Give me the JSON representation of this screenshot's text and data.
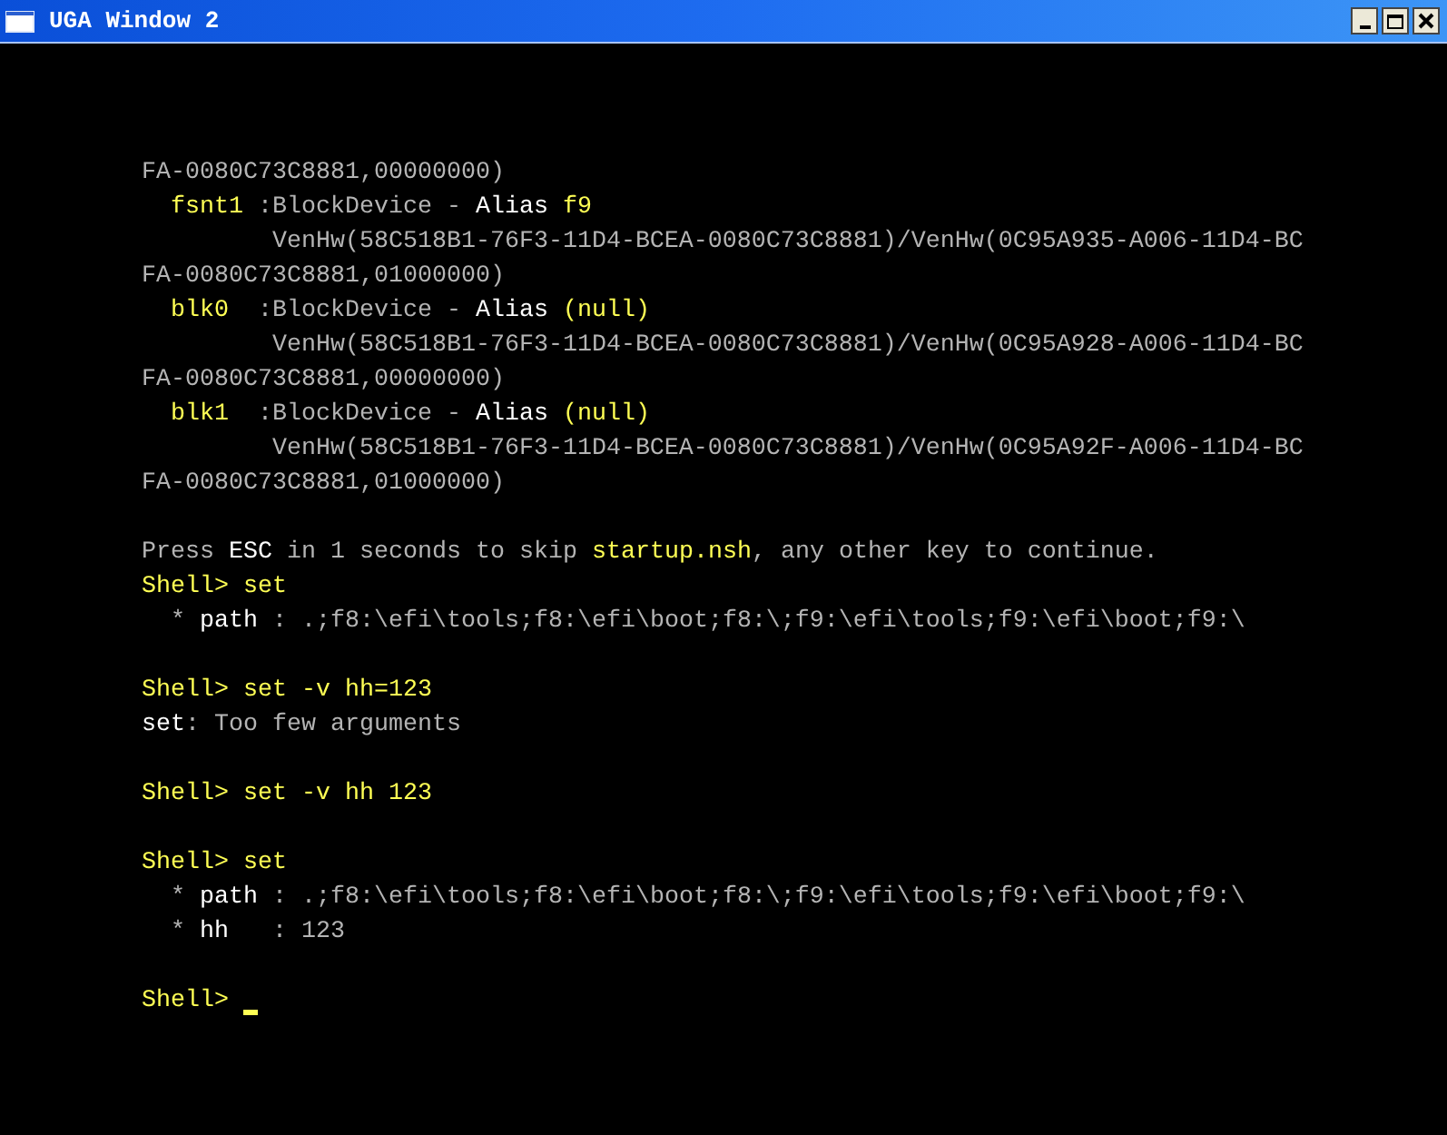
{
  "window": {
    "title": "UGA Window 2"
  },
  "terminal": {
    "lines": [
      {
        "kind": "text",
        "segments": [
          {
            "text": "FA-0080C73C8881,00000000)",
            "color": "#b4b4b4"
          }
        ]
      },
      {
        "kind": "text",
        "segments": [
          {
            "text": "  fsnt1",
            "color": "#ffff54"
          },
          {
            "text": " :BlockDevice - ",
            "color": "#b4b4b4"
          },
          {
            "text": "Alias ",
            "color": "#ffffff"
          },
          {
            "text": "f9",
            "color": "#ffff54"
          }
        ]
      },
      {
        "kind": "text",
        "segments": [
          {
            "text": "         VenHw(58C518B1-76F3-11D4-BCEA-0080C73C8881)/VenHw(0C95A935-A006-11D4-BC",
            "color": "#b4b4b4"
          }
        ]
      },
      {
        "kind": "text",
        "segments": [
          {
            "text": "FA-0080C73C8881,01000000)",
            "color": "#b4b4b4"
          }
        ]
      },
      {
        "kind": "text",
        "segments": [
          {
            "text": "  blk0",
            "color": "#ffff54"
          },
          {
            "text": "  :BlockDevice - ",
            "color": "#b4b4b4"
          },
          {
            "text": "Alias ",
            "color": "#ffffff"
          },
          {
            "text": "(null)",
            "color": "#ffff54"
          }
        ]
      },
      {
        "kind": "text",
        "segments": [
          {
            "text": "         VenHw(58C518B1-76F3-11D4-BCEA-0080C73C8881)/VenHw(0C95A928-A006-11D4-BC",
            "color": "#b4b4b4"
          }
        ]
      },
      {
        "kind": "text",
        "segments": [
          {
            "text": "FA-0080C73C8881,00000000)",
            "color": "#b4b4b4"
          }
        ]
      },
      {
        "kind": "text",
        "segments": [
          {
            "text": "  blk1",
            "color": "#ffff54"
          },
          {
            "text": "  :BlockDevice - ",
            "color": "#b4b4b4"
          },
          {
            "text": "Alias ",
            "color": "#ffffff"
          },
          {
            "text": "(null)",
            "color": "#ffff54"
          }
        ]
      },
      {
        "kind": "text",
        "segments": [
          {
            "text": "         VenHw(58C518B1-76F3-11D4-BCEA-0080C73C8881)/VenHw(0C95A92F-A006-11D4-BC",
            "color": "#b4b4b4"
          }
        ]
      },
      {
        "kind": "text",
        "segments": [
          {
            "text": "FA-0080C73C8881,01000000)",
            "color": "#b4b4b4"
          }
        ]
      },
      {
        "kind": "blank"
      },
      {
        "kind": "text",
        "segments": [
          {
            "text": "Press ",
            "color": "#b4b4b4"
          },
          {
            "text": "ESC",
            "color": "#ffffff"
          },
          {
            "text": " in 1 seconds to skip ",
            "color": "#b4b4b4"
          },
          {
            "text": "startup.nsh",
            "color": "#ffff54"
          },
          {
            "text": ", any other key to continue.",
            "color": "#b4b4b4"
          }
        ]
      },
      {
        "kind": "text",
        "segments": [
          {
            "text": "Shell> set",
            "color": "#ffff54"
          }
        ]
      },
      {
        "kind": "text",
        "segments": [
          {
            "text": "  * ",
            "color": "#b4b4b4"
          },
          {
            "text": "path",
            "color": "#ffffff"
          },
          {
            "text": " : .;f8:\\efi\\tools;f8:\\efi\\boot;f8:\\;f9:\\efi\\tools;f9:\\efi\\boot;f9:\\",
            "color": "#b4b4b4"
          }
        ]
      },
      {
        "kind": "blank"
      },
      {
        "kind": "text",
        "segments": [
          {
            "text": "Shell> set -v hh=123",
            "color": "#ffff54"
          }
        ]
      },
      {
        "kind": "text",
        "segments": [
          {
            "text": "set",
            "color": "#ffffff"
          },
          {
            "text": ": Too few arguments",
            "color": "#b4b4b4"
          }
        ]
      },
      {
        "kind": "blank"
      },
      {
        "kind": "text",
        "segments": [
          {
            "text": "Shell> set -v hh 123",
            "color": "#ffff54"
          }
        ]
      },
      {
        "kind": "blank"
      },
      {
        "kind": "text",
        "segments": [
          {
            "text": "Shell> set",
            "color": "#ffff54"
          }
        ]
      },
      {
        "kind": "text",
        "segments": [
          {
            "text": "  * ",
            "color": "#b4b4b4"
          },
          {
            "text": "path",
            "color": "#ffffff"
          },
          {
            "text": " : .;f8:\\efi\\tools;f8:\\efi\\boot;f8:\\;f9:\\efi\\tools;f9:\\efi\\boot;f9:\\",
            "color": "#b4b4b4"
          }
        ]
      },
      {
        "kind": "text",
        "segments": [
          {
            "text": "  * ",
            "color": "#b4b4b4"
          },
          {
            "text": "hh",
            "color": "#ffffff"
          },
          {
            "text": "   : 123",
            "color": "#b4b4b4"
          }
        ]
      },
      {
        "kind": "blank"
      },
      {
        "kind": "prompt",
        "segments": [
          {
            "text": "Shell>",
            "color": "#ffff54"
          }
        ]
      }
    ]
  }
}
